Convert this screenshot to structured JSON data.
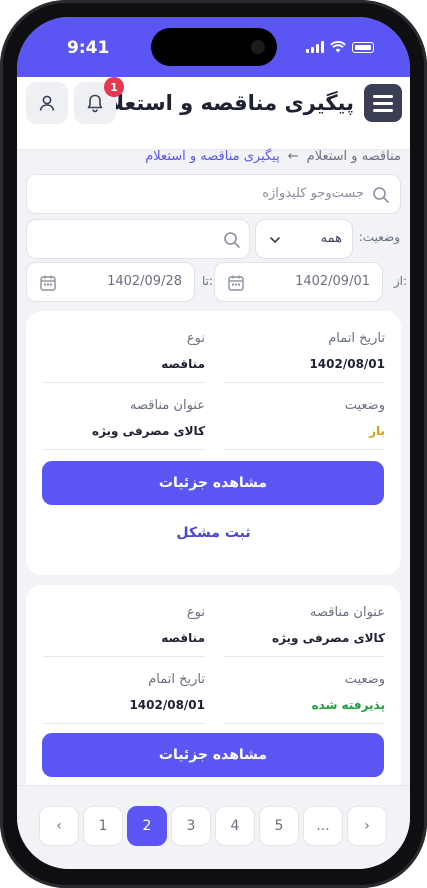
{
  "status_bar": {
    "time": "9:41"
  },
  "header": {
    "title": "پیگیری مناقصه و استعلام",
    "notification_count": "1"
  },
  "breadcrumb": {
    "parent": "مناقصه و استعلام",
    "separator": "←",
    "current": "پیگیری مناقصه و استعلام"
  },
  "filters": {
    "search_placeholder": "جست‌وجو کلیدواژه",
    "status_label": "وضعیت:",
    "status_value": "همه",
    "from_label": "از:",
    "from_date": "1402/09/01",
    "to_label": "تا:",
    "to_date": "1402/09/28"
  },
  "cards": [
    {
      "fields": [
        {
          "label": "تاریخ اتمام",
          "value": "1402/08/01"
        },
        {
          "label": "نوع",
          "value": "مناقصه"
        },
        {
          "label": "وضعیت",
          "value": "باز"
        },
        {
          "label": "عنوان مناقصه",
          "value": "کالای مصرفی ویژه"
        }
      ],
      "details_button": "مشاهده جزئیات",
      "report_link": "ثبت مشکل"
    },
    {
      "fields": [
        {
          "label": "عنوان مناقصه",
          "value": "کالای مصرفی ویژه"
        },
        {
          "label": "نوع",
          "value": "مناقصه"
        },
        {
          "label": "وضعیت",
          "value": "پذیرفته شده"
        },
        {
          "label": "تاریخ اتمام",
          "value": "1402/08/01"
        }
      ],
      "details_button": "مشاهده جزئیات"
    }
  ],
  "pagination": {
    "prev": "‹",
    "pages": [
      "1",
      "2",
      "3",
      "4",
      "5",
      "..."
    ],
    "active": "2",
    "next": "›"
  },
  "colors": {
    "accent": "#5b55f3",
    "open": "#d4a017",
    "accepted": "#1e9e3e",
    "badge": "#e53950"
  }
}
